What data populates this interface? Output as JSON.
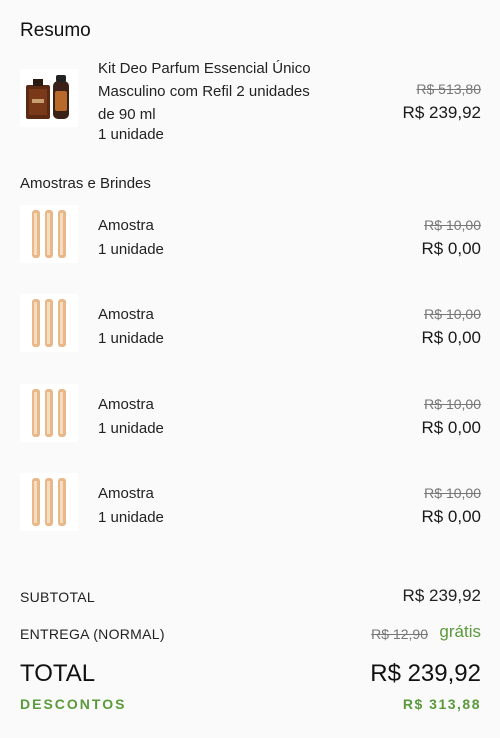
{
  "summary": {
    "title": "Resumo",
    "main_item": {
      "name_line1": "Kit Deo Parfum Essencial Único",
      "name_line2": "Masculino com Refil 2 unidades",
      "name_line3": "de 90 ml",
      "quantity": "1 unidade",
      "old_price": "R$ 513,80",
      "price": "R$ 239,92"
    },
    "samples_title": "Amostras e Brindes",
    "samples": [
      {
        "name": "Amostra",
        "quantity": "1 unidade",
        "old_price": "R$ 10,00",
        "price": "R$ 0,00"
      },
      {
        "name": "Amostra",
        "quantity": "1 unidade",
        "old_price": "R$ 10,00",
        "price": "R$ 0,00"
      },
      {
        "name": "Amostra",
        "quantity": "1 unidade",
        "old_price": "R$ 10,00",
        "price": "R$ 0,00"
      },
      {
        "name": "Amostra",
        "quantity": "1 unidade",
        "old_price": "R$ 10,00",
        "price": "R$ 0,00"
      }
    ]
  },
  "totals": {
    "subtotal_label": "SUBTOTAL",
    "subtotal_value": "R$ 239,92",
    "delivery_label": "ENTREGA (NORMAL)",
    "delivery_old": "R$ 12,90",
    "delivery_value": "grátis",
    "total_label": "TOTAL",
    "total_value": "R$ 239,92",
    "discount_label": "DESCONTOS",
    "discount_value": "R$ 313,88"
  },
  "colors": {
    "accent_green": "#5a9a3a"
  }
}
